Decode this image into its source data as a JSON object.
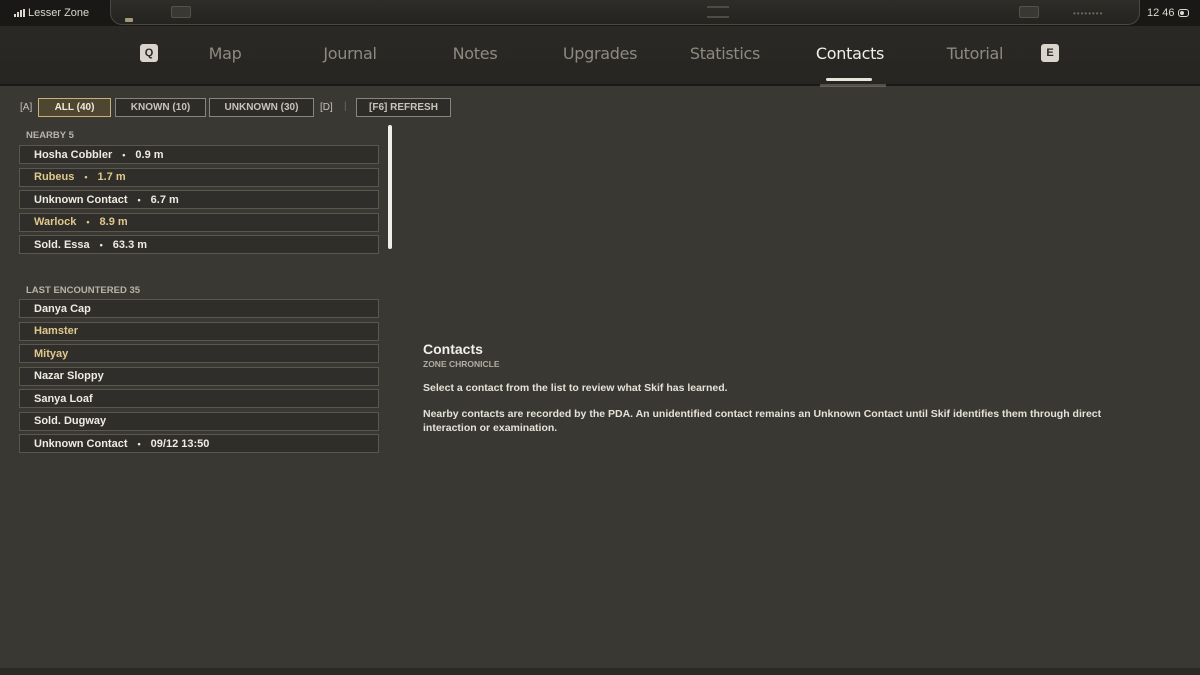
{
  "status_bar": {
    "zone_name": "Lesser Zone",
    "clock": "12 46",
    "icons": [
      "signal-icon",
      "battery-icon"
    ]
  },
  "tabs": {
    "left_key": "Q",
    "right_key": "E",
    "items": [
      {
        "label": "Map"
      },
      {
        "label": "Journal"
      },
      {
        "label": "Notes"
      },
      {
        "label": "Upgrades"
      },
      {
        "label": "Statistics"
      },
      {
        "label": "Contacts"
      },
      {
        "label": "Tutorial"
      }
    ],
    "active": "Contacts"
  },
  "filters": {
    "prev_key": "[A]",
    "next_key": "[D]",
    "separator": "|",
    "buttons": [
      {
        "label": "ALL (40)"
      },
      {
        "label": "KNOWN (10)"
      },
      {
        "label": "UNKNOWN (30)"
      }
    ],
    "active": "ALL (40)",
    "refresh_label": "[F6]  REFRESH"
  },
  "nearby": {
    "title": "NEARBY  5",
    "items": [
      {
        "name": "Hosha Cobbler",
        "detail": "0.9 m",
        "highlight": false
      },
      {
        "name": "Rubeus",
        "detail": "1.7 m",
        "highlight": true
      },
      {
        "name": "Unknown Contact",
        "detail": "6.7 m",
        "highlight": false
      },
      {
        "name": "Warlock",
        "detail": "8.9 m",
        "highlight": true
      },
      {
        "name": "Sold. Essa",
        "detail": "63.3 m",
        "highlight": false
      }
    ]
  },
  "last_encountered": {
    "title": "LAST ENCOUNTERED  35",
    "items": [
      {
        "name": "Danya Cap",
        "detail": "",
        "highlight": false
      },
      {
        "name": "Hamster",
        "detail": "",
        "highlight": true
      },
      {
        "name": "Mityay",
        "detail": "",
        "highlight": true
      },
      {
        "name": "Nazar Sloppy",
        "detail": "",
        "highlight": false
      },
      {
        "name": "Sanya Loaf",
        "detail": "",
        "highlight": false
      },
      {
        "name": "Sold. Dugway",
        "detail": "",
        "highlight": false
      },
      {
        "name": "Unknown Contact",
        "detail": "09/12 13:50",
        "highlight": false
      }
    ]
  },
  "detail": {
    "title": "Contacts",
    "subtitle": "ZONE CHRONICLE",
    "paragraph_1": "Select a contact from the list to review what Skif has learned.",
    "paragraph_2": "Nearby contacts are recorded by the PDA. An unidentified contact remains an Unknown Contact until Skif identifies them through direct interaction or examination."
  },
  "colors": {
    "background": "#3a3833",
    "highlight_text": "#e0c98b",
    "active_filter": "#c7b27a"
  }
}
